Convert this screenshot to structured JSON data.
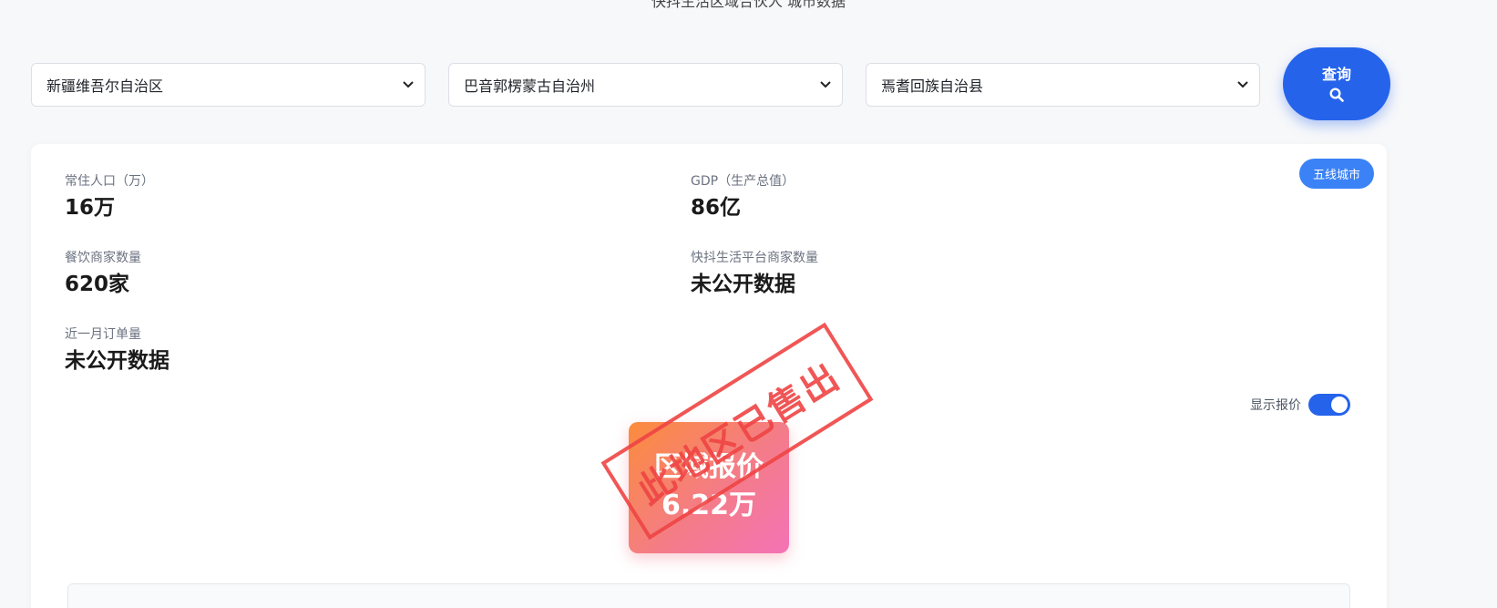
{
  "header": {
    "partial_title": "快抖生活区域合伙人 城市数据"
  },
  "filters": {
    "province": "新疆维吾尔自治区",
    "prefecture": "巴音郭楞蒙古自治州",
    "county": "焉耆回族自治县",
    "query_label": "查询"
  },
  "card": {
    "tier_badge": "五线城市",
    "stats": {
      "population": {
        "label": "常住人口（万）",
        "value": "16万"
      },
      "gdp": {
        "label": "GDP（生产总值）",
        "value": "86亿"
      },
      "restaurants": {
        "label": "餐饮商家数量",
        "value": "620家"
      },
      "platform_merchants": {
        "label": "快抖生活平台商家数量",
        "value": "未公开数据"
      },
      "monthly_orders": {
        "label": "近一月订单量",
        "value": "未公开数据"
      }
    },
    "toggle": {
      "label": "显示报价",
      "on": true
    },
    "price": {
      "title": "区域报价",
      "value": "6.22万"
    },
    "stamp": "此地区已售出"
  },
  "colors": {
    "accent": "#2563eb",
    "badge": "#3b82f6",
    "stamp": "#ef4444"
  }
}
